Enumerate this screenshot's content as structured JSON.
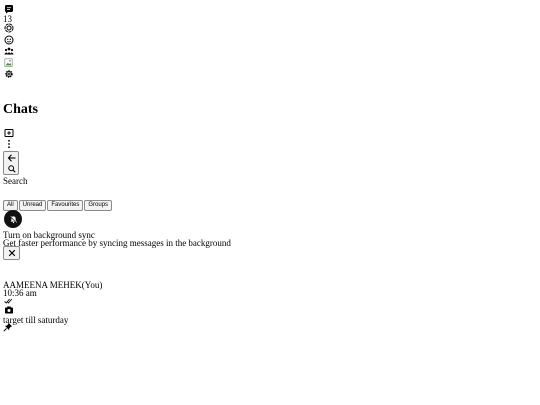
{
  "nav": {
    "chats_icon": "chat-square-icon",
    "unread_count": "13",
    "status_icon": "status-ring-icon",
    "channels_icon": "channels-icon",
    "communities_icon": "communities-icon",
    "profile_image": "broken-image",
    "settings_icon": "gear-icon"
  },
  "header": {
    "title": "Chats",
    "new_chat_icon": "new-chat-icon",
    "menu_icon": "kebab-menu-icon"
  },
  "search": {
    "back_icon": "arrow-left-icon",
    "search_icon": "search-icon",
    "placeholder": "Search"
  },
  "filters": [
    {
      "label": "All"
    },
    {
      "label": "Unread"
    },
    {
      "label": "Favourites"
    },
    {
      "label": "Groups"
    }
  ],
  "banner": {
    "icon": "bell-off-icon",
    "title": "Turn on background sync",
    "description": "Get faster performance by syncing messages in the background",
    "close_icon": "close-icon"
  },
  "chat_list": [
    {
      "name": "AAMEENA MEHEK(You)",
      "time": "10:36 am",
      "status_icon": "double-check-icon",
      "media_icon": "camera-icon",
      "preview": "target till saturday",
      "pin_icon": "pin-icon"
    }
  ]
}
